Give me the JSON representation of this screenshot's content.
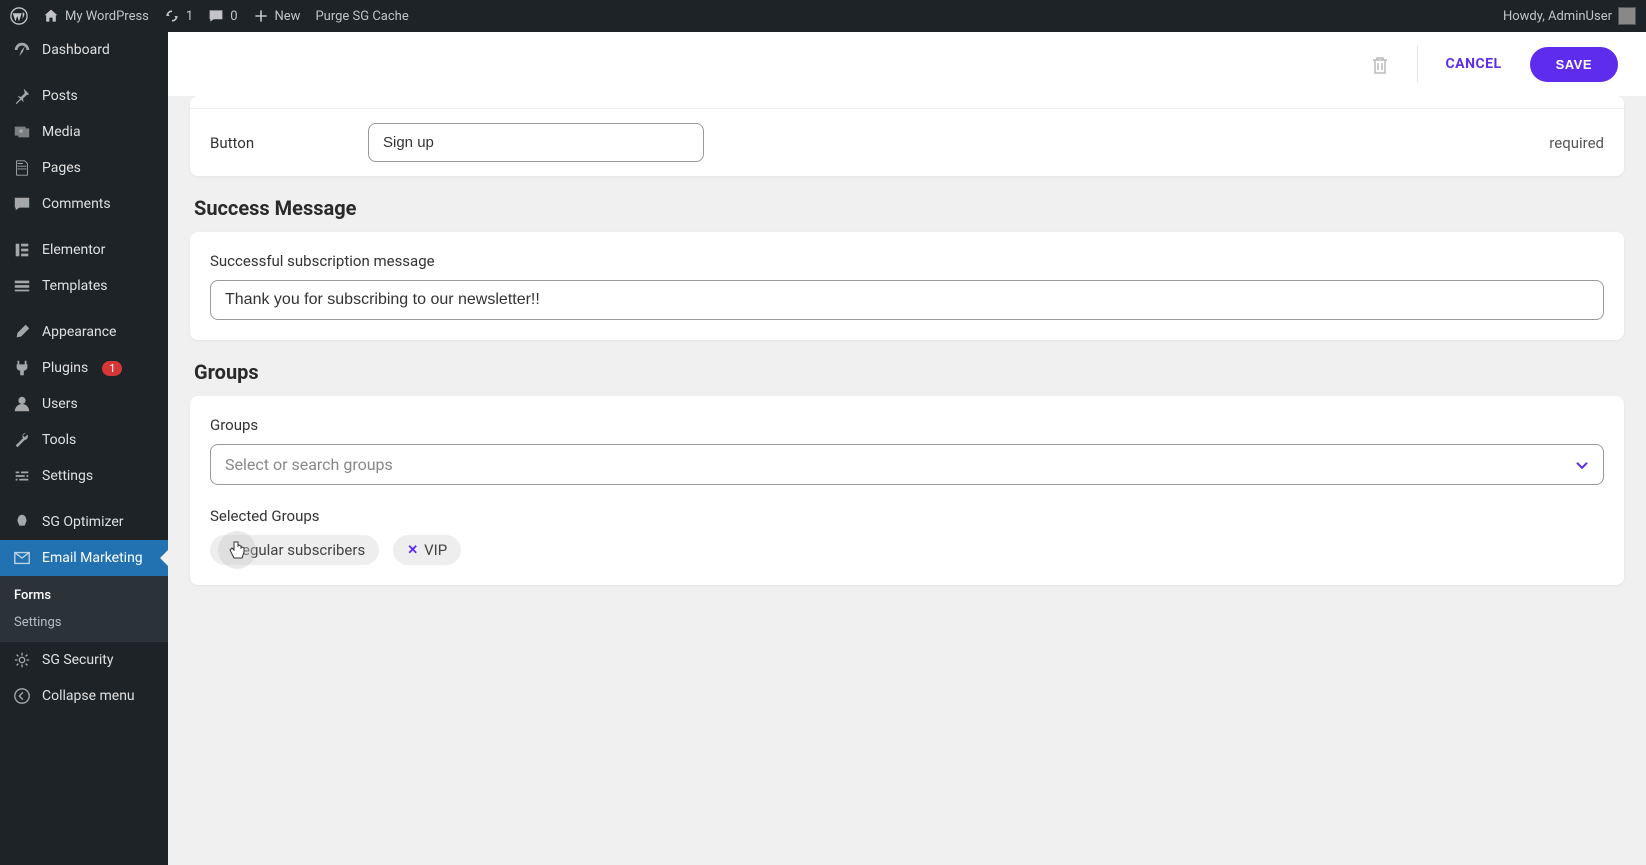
{
  "adminbar": {
    "site": "My WordPress",
    "updates": "1",
    "comments": "0",
    "new": "New",
    "purge": "Purge SG Cache",
    "howdy": "Howdy, AdminUser"
  },
  "sidebar": {
    "items": [
      {
        "label": "Dashboard"
      },
      {
        "label": "Posts"
      },
      {
        "label": "Media"
      },
      {
        "label": "Pages"
      },
      {
        "label": "Comments"
      },
      {
        "label": "Elementor"
      },
      {
        "label": "Templates"
      },
      {
        "label": "Appearance"
      },
      {
        "label": "Plugins",
        "badge": "1"
      },
      {
        "label": "Users"
      },
      {
        "label": "Tools"
      },
      {
        "label": "Settings"
      },
      {
        "label": "SG Optimizer"
      },
      {
        "label": "Email Marketing",
        "active": true
      },
      {
        "label": "SG Security"
      },
      {
        "label": "Collapse menu"
      }
    ],
    "submenu": [
      {
        "label": "Forms",
        "active": true
      },
      {
        "label": "Settings"
      }
    ]
  },
  "topbar": {
    "cancel": "CANCEL",
    "save": "SAVE"
  },
  "form": {
    "button_label": "Button",
    "button_value": "Sign up",
    "required": "required"
  },
  "success": {
    "heading": "Success Message",
    "label": "Successful subscription message",
    "value": "Thank you for subscribing to our newsletter!!"
  },
  "groups": {
    "heading": "Groups",
    "label": "Groups",
    "placeholder": "Select or search groups",
    "selected_label": "Selected Groups",
    "chips": [
      {
        "label": "egular subscribers"
      },
      {
        "label": "VIP"
      }
    ]
  }
}
